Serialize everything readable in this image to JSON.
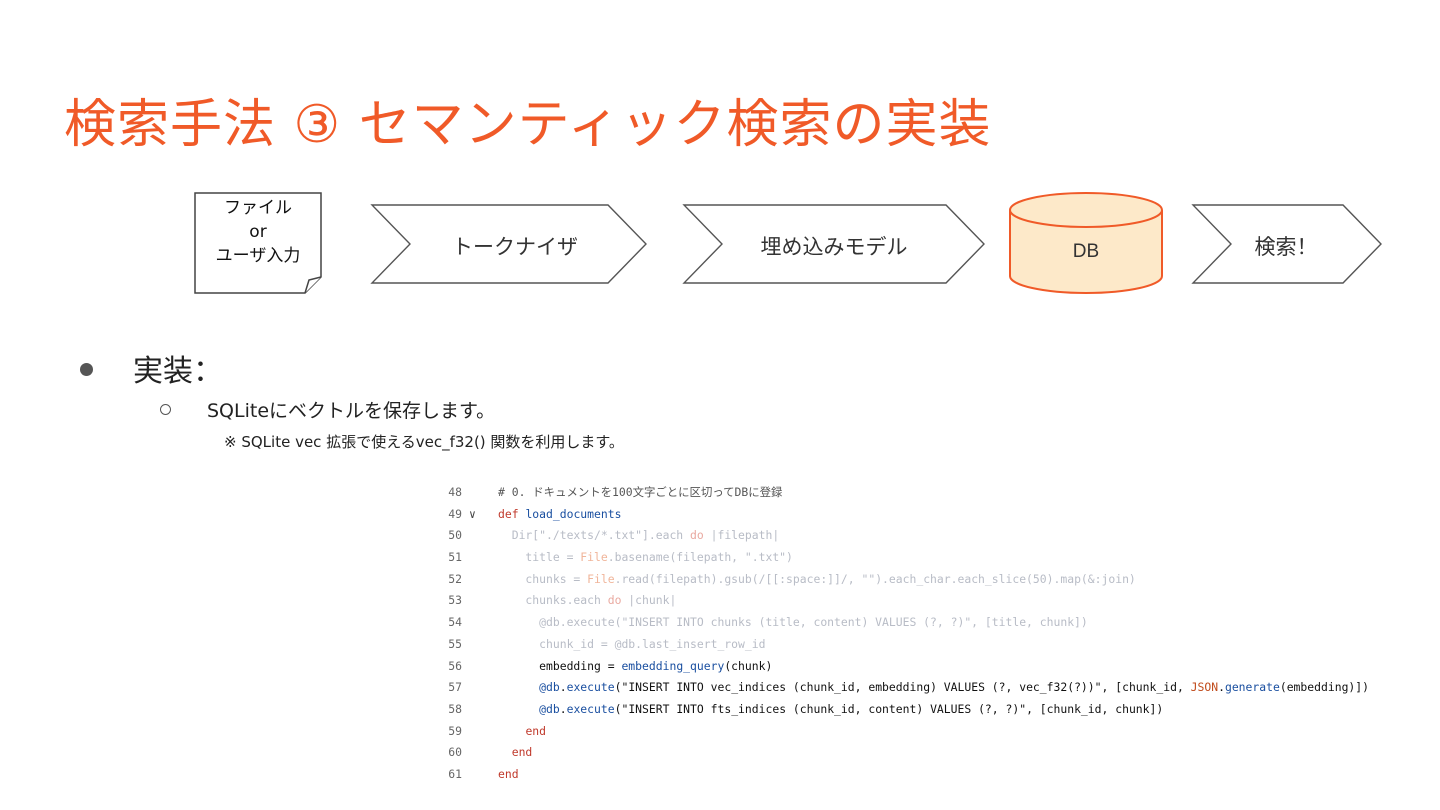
{
  "slide": {
    "title": "検索手法 ③ セマンティック検索の実装"
  },
  "flow": {
    "doc_lines": [
      "ファイル",
      "or",
      "ユーザ入力"
    ],
    "steps": [
      "トークナイザ",
      "埋め込みモデル",
      "DB",
      "検索！"
    ],
    "colors": {
      "arrow_stroke": "#555555",
      "db_fill": "#fde9c9",
      "db_stroke": "#f05a28"
    }
  },
  "bullets": {
    "level1": "実装：",
    "level2": "SQLiteにベクトルを保存します。",
    "note": "※ SQLite vec 拡張で使えるvec_f32() 関数を利用します。"
  },
  "code": {
    "line_numbers": [
      "48",
      "49",
      "50",
      "51",
      "52",
      "53",
      "54",
      "55",
      "56",
      "57",
      "58",
      "59",
      "60",
      "61"
    ],
    "lines": [
      "# 0. ドキュメントを100文字ごとに区切ってDBに登録",
      "def load_documents",
      "  Dir[\"./texts/*.txt\"].each do |filepath|",
      "    title = File.basename(filepath, \".txt\")",
      "    chunks = File.read(filepath).gsub(/[[:space:]]/, \"\").each_char.each_slice(50).map(&:join)",
      "    chunks.each do |chunk|",
      "      @db.execute(\"INSERT INTO chunks (title, content) VALUES (?, ?)\", [title, chunk])",
      "      chunk_id = @db.last_insert_row_id",
      "      embedding = embedding_query(chunk)",
      "      @db.execute(\"INSERT INTO vec_indices (chunk_id, embedding) VALUES (?, vec_f32(?))\", [chunk_id, JSON.generate(embedding)])",
      "      @db.execute(\"INSERT INTO fts_indices (chunk_id, content) VALUES (?, ?)\", [chunk_id, chunk])",
      "    end",
      "  end",
      "end"
    ]
  },
  "colors": {
    "title": "#f05a28"
  }
}
